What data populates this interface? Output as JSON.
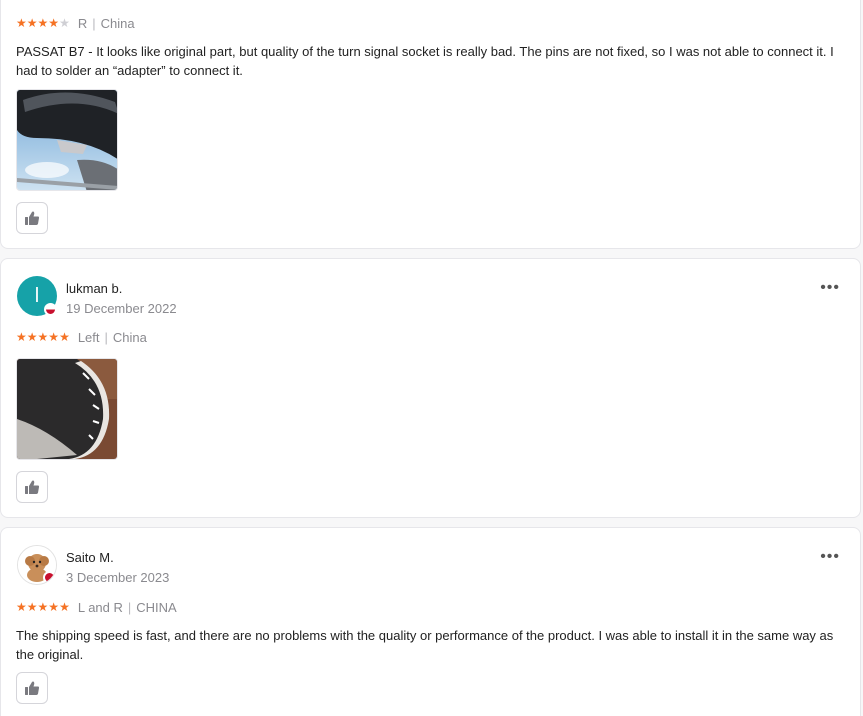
{
  "reviews": [
    {
      "rating": 4,
      "variant": "R",
      "country": "China",
      "text": "PASSAT B7 - It looks like original part, but quality of the turn signal socket is really bad. The pins are not fixed, so I was not able to connect it. I had to solder an “adapter” to connect it.",
      "photo_icon": "mirror-photo",
      "like_icon": "thumbs-up-icon"
    },
    {
      "avatar_letter": "l",
      "name": "lukman b.",
      "date": "19 December 2022",
      "rating": 5,
      "variant": "Left",
      "country": "China",
      "photo_icon": "mirror-photo",
      "like_icon": "thumbs-up-icon",
      "more_label": "•••"
    },
    {
      "avatar_icon": "dog-avatar",
      "name": "Saito M.",
      "date": "3 December 2023",
      "rating": 5,
      "variant": "L and R",
      "country": "CHINA",
      "text": "The shipping speed is fast, and there are no problems with the quality or performance of the product. I was able to install it in the same way as the original.",
      "like_icon": "thumbs-up-icon",
      "more_label": "•••"
    }
  ],
  "separator": "|",
  "colors": {
    "star": "#f57224",
    "star_empty": "#cfcfd4",
    "avatar_teal": "#16a2a8",
    "flag_red": "#c8102e",
    "muted_text": "#8a8a8f",
    "card_border": "#e6e6ea"
  }
}
